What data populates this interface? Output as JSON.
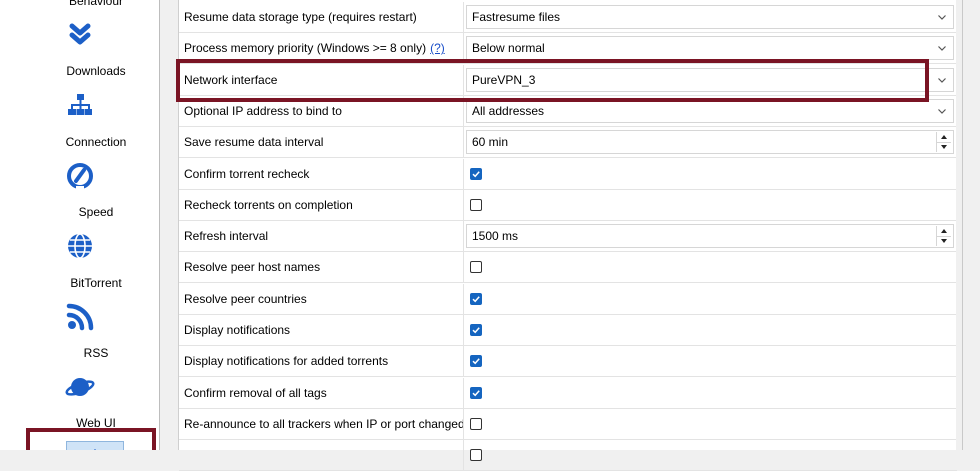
{
  "sidebar": {
    "items": [
      {
        "label": "Behaviour",
        "icon": "behaviour-icon"
      },
      {
        "label": "Downloads",
        "icon": "downloads-icon"
      },
      {
        "label": "Connection",
        "icon": "connection-icon"
      },
      {
        "label": "Speed",
        "icon": "speed-icon"
      },
      {
        "label": "BitTorrent",
        "icon": "bittorrent-icon"
      },
      {
        "label": "RSS",
        "icon": "rss-icon"
      },
      {
        "label": "Web UI",
        "icon": "webui-icon"
      },
      {
        "label": "",
        "icon": "advanced-icon"
      }
    ],
    "icon_color": "#1c5fc7"
  },
  "settings": {
    "rows": [
      {
        "label": "Resume data storage type (requires restart)",
        "type": "combo",
        "value": "Fastresume files"
      },
      {
        "label": "Process memory priority (Windows >= 8 only)",
        "help": "(?)",
        "type": "combo",
        "value": "Below normal"
      },
      {
        "label": "Network interface",
        "type": "combo",
        "value": "PureVPN_3"
      },
      {
        "label": "Optional IP address to bind to",
        "type": "combo",
        "value": "All addresses"
      },
      {
        "label": "Save resume data interval",
        "type": "spin",
        "value": "60 min"
      },
      {
        "label": "Confirm torrent recheck",
        "type": "check",
        "checked": true
      },
      {
        "label": "Recheck torrents on completion",
        "type": "check",
        "checked": false
      },
      {
        "label": "Refresh interval",
        "type": "spin",
        "value": "1500 ms"
      },
      {
        "label": "Resolve peer host names",
        "type": "check",
        "checked": false
      },
      {
        "label": "Resolve peer countries",
        "type": "check",
        "checked": true
      },
      {
        "label": "Display notifications",
        "type": "check",
        "checked": true
      },
      {
        "label": "Display notifications for added torrents",
        "type": "check",
        "checked": true
      },
      {
        "label": "Confirm removal of all tags",
        "type": "check",
        "checked": true
      },
      {
        "label": "Re-announce to all trackers when IP or port changed",
        "type": "check",
        "checked": false
      },
      {
        "label": "",
        "type": "check",
        "checked": false
      }
    ]
  },
  "highlight_color": "#7a1424",
  "checkbox_color": "#1565c0"
}
